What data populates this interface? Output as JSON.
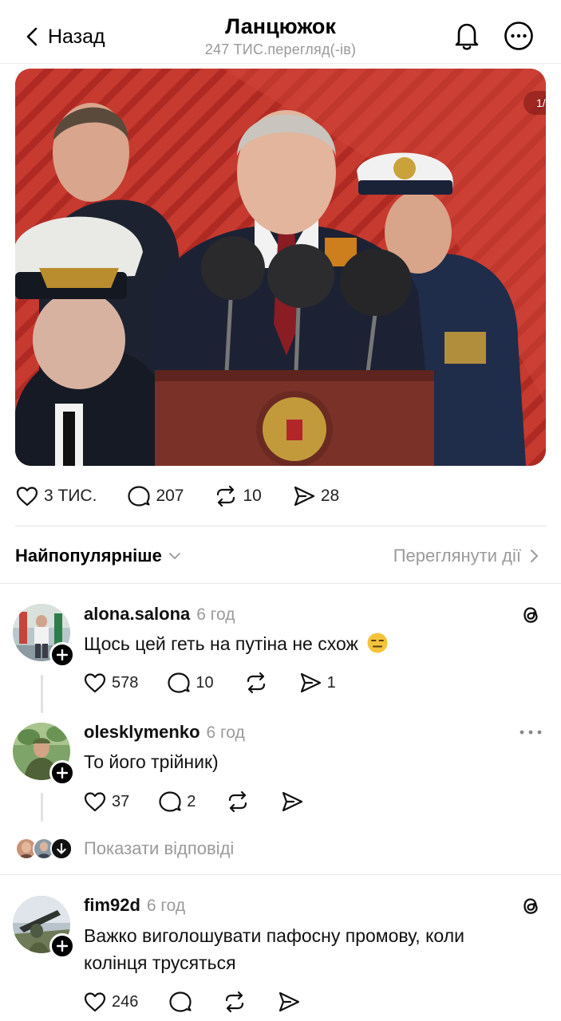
{
  "header": {
    "back_label": "Назад",
    "title": "Ланцюжок",
    "views": "247 ТИС.перегляд(-ів)"
  },
  "post": {
    "image_counter": "1/",
    "likes": "3 ТИС.",
    "comments": "207",
    "reposts": "10",
    "shares": "28"
  },
  "sort": {
    "label": "Найпопулярніше",
    "view_activity": "Переглянути дії"
  },
  "comments": [
    {
      "username": "alona.salona",
      "time": "6 год",
      "text": "Щось цей геть на путіна не схож",
      "emoji": "expressionless-face",
      "likes": "578",
      "replies": "10",
      "reposts": "",
      "shares": "1"
    },
    {
      "username": "olesklymenko",
      "time": "6 год",
      "text": "То його трійник)",
      "likes": "37",
      "replies": "2",
      "reposts": "",
      "shares": ""
    },
    {
      "username": "fim92d",
      "time": "6 год",
      "text_line1": "Важко виголошувати пафосну промову, коли",
      "text_line2": "колінця трусяться",
      "likes": "246"
    }
  ],
  "show_replies_label": "Показати відповіді",
  "colors": {
    "text": "#000000",
    "muted": "#9a9a9a",
    "divider": "#e6e6e6",
    "backdrop_red": "#c9312a"
  }
}
